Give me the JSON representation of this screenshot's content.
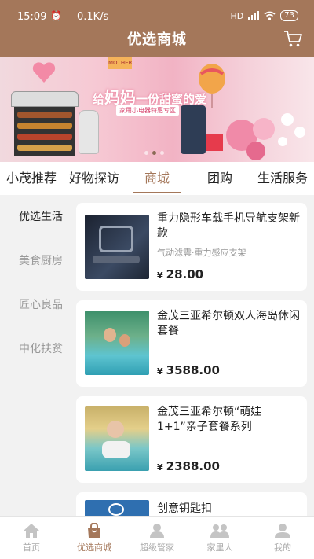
{
  "status_bar": {
    "time": "15:09",
    "speed": "0.1K/s",
    "hd": "HD",
    "battery": "73"
  },
  "header": {
    "title": "优选商城"
  },
  "banner": {
    "tag": "MOTHER",
    "slogan_prefix": "给",
    "slogan_big": "妈妈",
    "slogan_rest": "一份甜蜜的爱",
    "subtag": "家用小电器特惠专区",
    "slide_count": 3,
    "active_slide": 1
  },
  "category_tabs": [
    {
      "label": "小茂推荐"
    },
    {
      "label": "好物探访"
    },
    {
      "label": "商城"
    },
    {
      "label": "团购"
    },
    {
      "label": "生活服务"
    }
  ],
  "active_tab": 2,
  "sidebar": {
    "items": [
      {
        "label": "优选生活"
      },
      {
        "label": "美食厨房"
      },
      {
        "label": "匠心良品"
      },
      {
        "label": "中化扶贫"
      }
    ]
  },
  "products": [
    {
      "name": "重力隐形车载手机导航支架新款",
      "desc": "气动滤震·重力感应支架",
      "currency": "¥",
      "price": "28.00"
    },
    {
      "name": "金茂三亚希尔顿双人海岛休闲套餐",
      "desc": "",
      "currency": "¥",
      "price": "3588.00"
    },
    {
      "name": "金茂三亚希尔顿“萌娃1+1”亲子套餐系列",
      "desc": "",
      "currency": "¥",
      "price": "2388.00"
    },
    {
      "name": "创意钥匙扣",
      "desc": "",
      "currency": "",
      "price": ""
    }
  ],
  "bottom_nav": [
    {
      "label": "首页",
      "icon": "home-icon"
    },
    {
      "label": "优选商城",
      "icon": "shopping-bag-icon"
    },
    {
      "label": "超级管家",
      "icon": "butler-icon"
    },
    {
      "label": "家里人",
      "icon": "family-icon"
    },
    {
      "label": "我的",
      "icon": "profile-icon"
    }
  ],
  "colors": {
    "brand": "#a4775a",
    "text": "#222222",
    "muted": "#999999"
  }
}
